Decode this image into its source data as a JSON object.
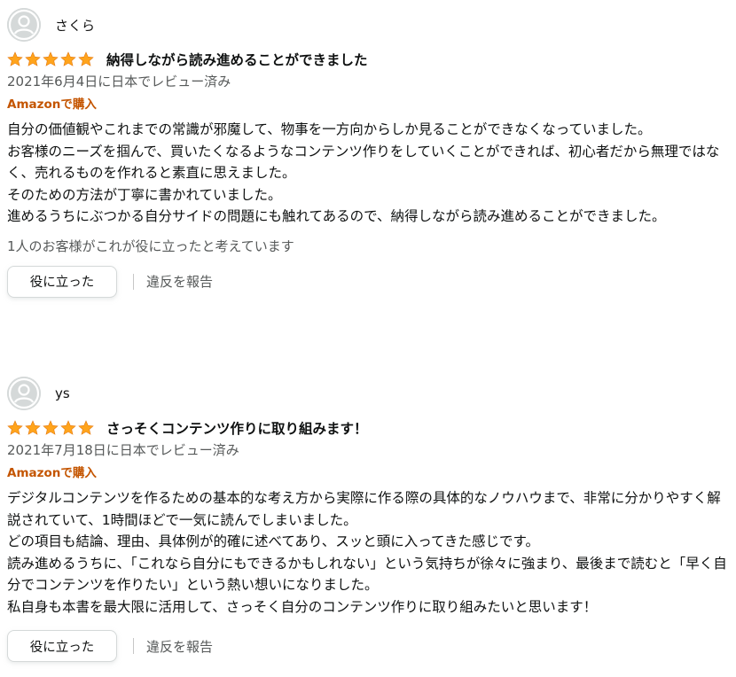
{
  "colors": {
    "star": "#ffa41c",
    "verified": "#c45500",
    "secondary_text": "#565959",
    "avatar_bg": "#d5d9d9"
  },
  "reviews": [
    {
      "author": "さくら",
      "rating": 5,
      "title": "納得しながら読み進めることができました",
      "date": "2021年6月4日に日本でレビュー済み",
      "verified": "Amazonで購入",
      "body": [
        "自分の価値観やこれまでの常識が邪魔して、物事を一方向からしか見ることができなくなっていました。",
        "お客様のニーズを掴んで、買いたくなるようなコンテンツ作りをしていくことができれば、初心者だから無理ではなく、売れるものを作れると素直に思えました。",
        "そのための方法が丁寧に書かれていました。",
        "進めるうちにぶつかる自分サイドの問題にも触れてあるので、納得しながら読み進めることができました。"
      ],
      "helpful_count": "1人のお客様がこれが役に立ったと考えています",
      "helpful_button": "役に立った",
      "report_link": "違反を報告"
    },
    {
      "author": "ys",
      "rating": 5,
      "title": "さっそくコンテンツ作りに取り組みます！",
      "date": "2021年7月18日に日本でレビュー済み",
      "verified": "Amazonで購入",
      "body": [
        "デジタルコンテンツを作るための基本的な考え方から実際に作る際の具体的なノウハウまで、非常に分かりやすく解説されていて、1時間ほどで一気に読んでしまいました。",
        "どの項目も結論、理由、具体例が的確に述べてあり、スッと頭に入ってきた感じです。",
        "読み進めるうちに、「これなら自分にもできるかもしれない」という気持ちが徐々に強まり、最後まで読むと「早く自分でコンテンツを作りたい」という熱い想いになりました。",
        "私自身も本書を最大限に活用して、さっそく自分のコンテンツ作りに取り組みたいと思います！"
      ],
      "helpful_button": "役に立った",
      "report_link": "違反を報告"
    }
  ]
}
